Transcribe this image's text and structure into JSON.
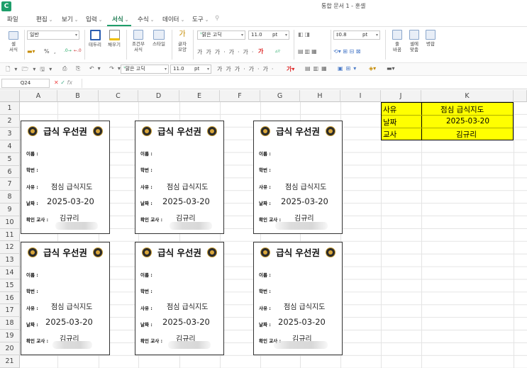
{
  "app": {
    "logo_letter": "C",
    "window_title": "통합 문서 1 - 훈셀"
  },
  "menu": [
    "파일",
    "편집",
    "보기",
    "입력",
    "서식",
    "수식",
    "데이터",
    "도구"
  ],
  "ribbon": {
    "cell_style_label": "셀\n서식",
    "font_style_combo": "일반",
    "percent": "%",
    "comma": ",",
    "border_label": "테두리",
    "fill_label": "채우기",
    "conditional_label": "조건부\n서식",
    "style_label": "스타일",
    "textshape_label": "글자\n모양",
    "font_name": "맑은 고딕",
    "font_size": "11.0",
    "font_unit": "pt",
    "line_spacing": "0.8",
    "line_unit": "pt",
    "wrap_label": "줄\n바꿈",
    "fit_label": "셀에\n맞춤",
    "merge_label": "병합"
  },
  "toolbar2": {
    "font_name": "맑은 고딕",
    "font_size": "11.0",
    "font_unit": "pt"
  },
  "formula_bar": {
    "name_box": "Q24",
    "fx": "fx",
    "value": ""
  },
  "columns": [
    "A",
    "B",
    "C",
    "D",
    "E",
    "F",
    "G",
    "H",
    "I",
    "J",
    "K"
  ],
  "rows": [
    "1",
    "2",
    "3",
    "4",
    "5",
    "6",
    "7",
    "8",
    "9",
    "10",
    "11",
    "12",
    "13",
    "14",
    "15",
    "16",
    "17",
    "18",
    "19",
    "20",
    "21"
  ],
  "info": {
    "r1_label": "사유",
    "r1_value": "점심 급식지도",
    "r2_label": "날짜",
    "r2_value": "2025-03-20",
    "r3_label": "교사",
    "r3_value": "김규리"
  },
  "coupon": {
    "title": "급식 우선권",
    "name_label": "이름 :",
    "id_label": "학번 :",
    "reason_label": "사유 :",
    "reason_value": "점심 급식지도",
    "date_label": "날짜 :",
    "date_value": "2025-03-20",
    "teacher_label": "확인 교사 :",
    "teacher_value": "김규리"
  },
  "colors": {
    "accent": "#1e9e6a",
    "highlight": "#ffff00"
  }
}
